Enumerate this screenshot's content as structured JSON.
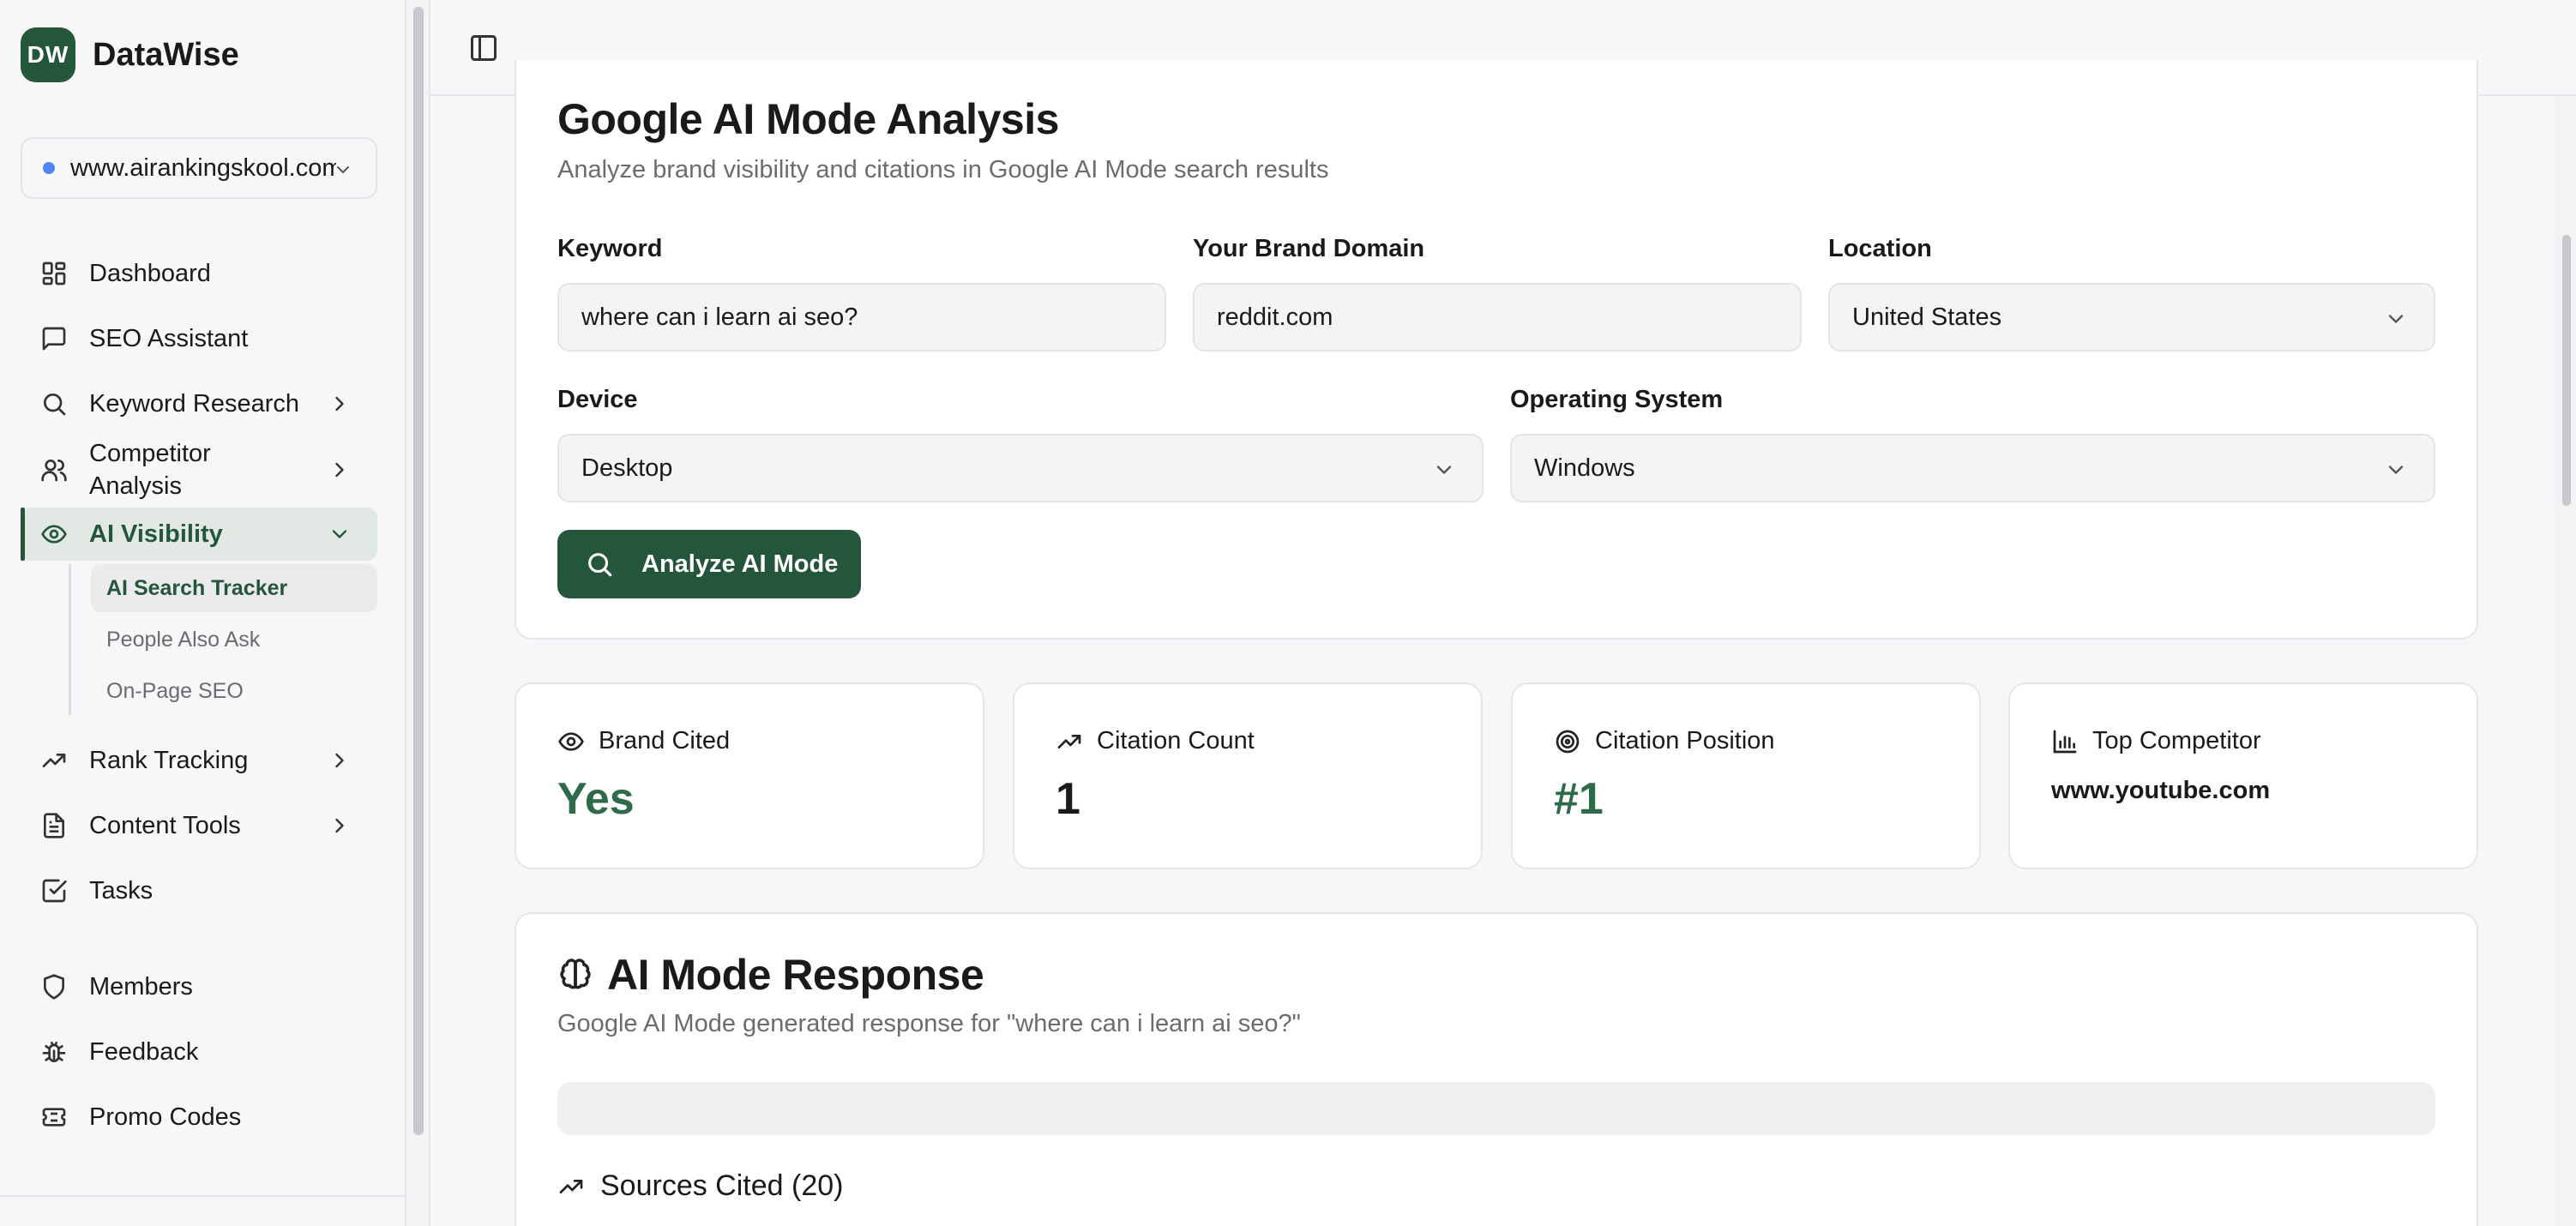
{
  "app": {
    "logo_text": "DW",
    "name": "DataWise"
  },
  "site_selector": {
    "value": "www.airankingskool.com"
  },
  "sidebar": {
    "items": [
      {
        "label": "Dashboard",
        "icon": "grid-icon"
      },
      {
        "label": "SEO Assistant",
        "icon": "message-icon"
      },
      {
        "label": "Keyword Research",
        "icon": "search-icon"
      },
      {
        "label": "Competitor Analysis",
        "icon": "users-icon"
      },
      {
        "label": "AI Visibility",
        "icon": "eye-icon"
      },
      {
        "label": "Rank Tracking",
        "icon": "trending-up-icon"
      },
      {
        "label": "Content Tools",
        "icon": "file-text-icon"
      },
      {
        "label": "Tasks",
        "icon": "check-square-icon"
      },
      {
        "label": "Members",
        "icon": "shield-icon"
      },
      {
        "label": "Feedback",
        "icon": "bug-icon"
      },
      {
        "label": "Promo Codes",
        "icon": "ticket-icon"
      }
    ],
    "ai_visibility_sub": [
      {
        "label": "AI Search Tracker"
      },
      {
        "label": "People Also Ask"
      },
      {
        "label": "On-Page SEO"
      }
    ]
  },
  "analysis": {
    "title": "Google AI Mode Analysis",
    "subtitle": "Analyze brand visibility and citations in Google AI Mode search results",
    "keyword_label": "Keyword",
    "keyword_value": "where can i learn ai seo?",
    "domain_label": "Your Brand Domain",
    "domain_value": "reddit.com",
    "location_label": "Location",
    "location_value": "United States",
    "device_label": "Device",
    "device_value": "Desktop",
    "os_label": "Operating System",
    "os_value": "Windows",
    "button_label": "Analyze AI Mode"
  },
  "stats": [
    {
      "label": "Brand Cited",
      "value": "Yes",
      "icon": "eye-icon"
    },
    {
      "label": "Citation Count",
      "value": "1",
      "icon": "trending-up-icon"
    },
    {
      "label": "Citation Position",
      "value": "#1",
      "icon": "target-icon"
    },
    {
      "label": "Top Competitor",
      "value": "www.youtube.com",
      "icon": "bar-chart-icon"
    }
  ],
  "response": {
    "title": "AI Mode Response",
    "subtitle": "Google AI Mode generated response for \"where can i learn ai seo?\"",
    "sources_label": "Sources Cited (20)"
  },
  "colors": {
    "brand": "#24563b",
    "accent_green": "#2e6b4a",
    "site_dot": "#4f86f7"
  }
}
